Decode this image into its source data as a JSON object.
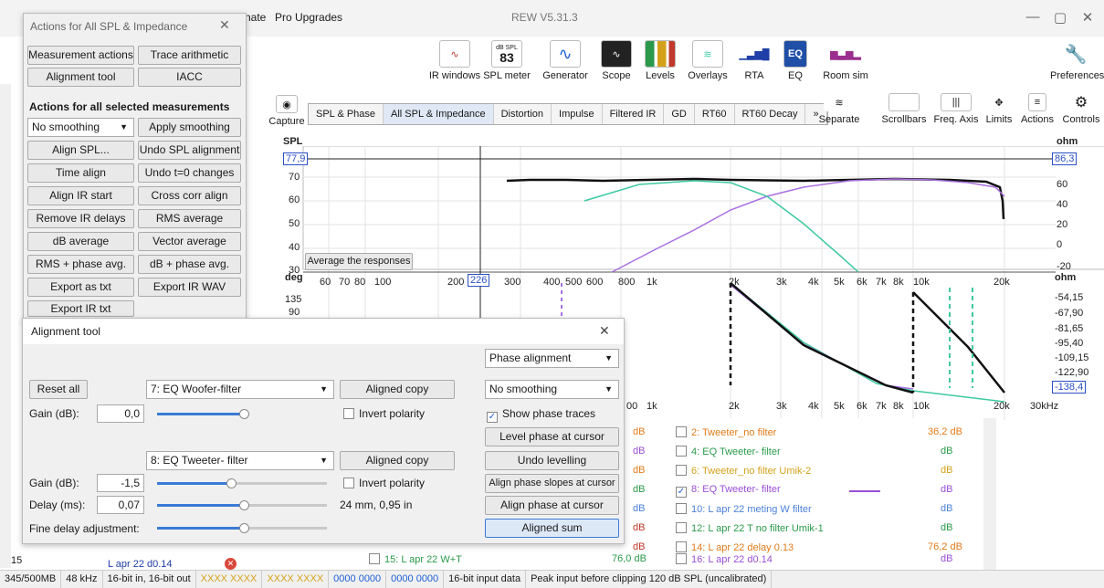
{
  "window": {
    "title": "REW V5.31.3",
    "menus": [
      "nate",
      "Pro Upgrades"
    ]
  },
  "toolbar": {
    "buttons": [
      {
        "label": "IR windows",
        "icon": "ir-windows-icon"
      },
      {
        "label": "SPL meter",
        "icon": "spl-meter-icon",
        "top": "dB SPL",
        "value": "83"
      },
      {
        "label": "Generator",
        "icon": "generator-icon"
      },
      {
        "label": "Scope",
        "icon": "scope-icon"
      },
      {
        "label": "Levels",
        "icon": "levels-icon"
      },
      {
        "label": "Overlays",
        "icon": "overlays-icon"
      },
      {
        "label": "RTA",
        "icon": "rta-icon"
      },
      {
        "label": "EQ",
        "icon": "eq-icon"
      },
      {
        "label": "Room sim",
        "icon": "room-sim-icon"
      }
    ],
    "preferences": "Preferences"
  },
  "graph_toolbar": {
    "capture": "Capture",
    "tabs": [
      "SPL & Phase",
      "All SPL & Impedance",
      "Distortion",
      "Impulse",
      "Filtered IR",
      "GD",
      "RT60",
      "RT60 Decay",
      "»"
    ],
    "selected_tab": "All SPL & Impedance",
    "controls": [
      "Separate",
      "Scrollbars",
      "Freq. Axis",
      "Limits",
      "Actions",
      "Controls"
    ]
  },
  "graph": {
    "spl_label": "SPL",
    "ohm_label": "ohm",
    "deg_label": "deg",
    "spl_cursor": "77,9",
    "ohm_cursor": "86,3",
    "spl_ticks": [
      "70",
      "60",
      "50",
      "40",
      "30"
    ],
    "ohm_ticks": [
      "60",
      "40",
      "20",
      "0",
      "-20"
    ],
    "deg_ticks": [
      "135",
      "90"
    ],
    "phase_ticks": [
      "-54,15",
      "-67,90",
      "-81,65",
      "-95,40",
      "-109,15",
      "-122,90"
    ],
    "phase_cursor": "-138,4",
    "freq_cursor": "226",
    "avg_button": "Average the responses",
    "top_freqs": [
      "60",
      "70",
      "80",
      "100",
      "200",
      "300",
      "400",
      "500",
      "600",
      "800",
      "1k",
      "2k",
      "3k",
      "4k",
      "5k",
      "6k",
      "7k",
      "8k",
      "10k",
      "20k"
    ],
    "bottom_freqs": [
      "00",
      "1k",
      "2k",
      "3k",
      "4k",
      "5k",
      "6k",
      "7k",
      "8k",
      "10k",
      "20k",
      "30kHz"
    ]
  },
  "actions_panel": {
    "title": "Actions for All SPL & Impedance",
    "buttons_top": [
      "Measurement actions",
      "Trace arithmetic",
      "Alignment tool",
      "IACC"
    ],
    "section": "Actions for all selected measurements",
    "smoothing": "No smoothing",
    "buttons": [
      "Apply smoothing",
      "Align SPL...",
      "Undo SPL alignment",
      "Time align",
      "Undo t=0 changes",
      "Align IR start",
      "Cross corr align",
      "Remove IR delays",
      "RMS average",
      "dB average",
      "Vector average",
      "RMS + phase avg.",
      "dB + phase avg.",
      "Export as txt",
      "Export IR WAV",
      "Export IR txt"
    ]
  },
  "alignment_tool": {
    "title": "Alignment tool",
    "reset": "Reset all",
    "phase_mode": "Phase alignment",
    "smoothing": "No smoothing",
    "show_phase": "Show phase traces",
    "level_phase": "Level phase at cursor",
    "undo_levelling": "Undo levelling",
    "align_slopes": "Align phase slopes at cursor",
    "align_phase": "Align phase at cursor",
    "aligned_sum": "Aligned sum",
    "m1": {
      "name": "7: EQ Woofer-filter",
      "copy": "Aligned copy",
      "gain_label": "Gain (dB):",
      "gain": "0,0",
      "invert": "Invert polarity"
    },
    "m2": {
      "name": "8: EQ Tweeter- filter",
      "copy": "Aligned copy",
      "gain_label": "Gain (dB):",
      "gain": "-1,5",
      "invert": "Invert polarity",
      "delay_label": "Delay (ms):",
      "delay": "0,07",
      "delay_info": "24 mm, 0,95 in",
      "fine_label": "Fine delay adjustment:"
    }
  },
  "measurements": [
    {
      "name": "2: Tweeter_no filter",
      "value": "36,2 dB",
      "color": "#e07b1a",
      "checked": false
    },
    {
      "name": "4: EQ Tweeter- filter",
      "value": "dB",
      "color": "#2a9a4a",
      "checked": false
    },
    {
      "name": "6: Tweeter_no filter Umik-2",
      "value": "dB",
      "color": "#d4a21a",
      "checked": false
    },
    {
      "name": "8: EQ Tweeter- filter",
      "value": "dB",
      "color": "#9b4fd6",
      "checked": true
    },
    {
      "name": "10: L apr 22 meting W filter",
      "value": "dB",
      "color": "#4a7fd6",
      "checked": false
    },
    {
      "name": "12: L apr 22 T no filter Umik-1",
      "value": "dB",
      "color": "#2a9a4a",
      "checked": false
    },
    {
      "name": "14: L apr 22 delay 0.13",
      "value": "76,2 dB",
      "color": "#e07b1a",
      "checked": false
    },
    {
      "name": "16: L apr 22 d0.14",
      "value": "dB",
      "color": "#9b4fd6",
      "checked": false
    }
  ],
  "left_list": [
    {
      "name": "15: L apr 22 W+T",
      "value": "76,0 dB",
      "color": "#2a9a4a"
    }
  ],
  "left_units": [
    "dB",
    "dB",
    "dB",
    "dB",
    "dB",
    "dB",
    "dB"
  ],
  "sidebar_rows": [
    {
      "num": "15",
      "name": "L apr 22 d0.14"
    }
  ],
  "status": [
    "345/500MB",
    "48 kHz",
    "16-bit in, 16-bit out",
    "XXXX XXXX",
    "XXXX XXXX",
    "0000 0000",
    "0000 0000",
    "16-bit input data",
    "Peak input before clipping 120 dB SPL (uncalibrated)"
  ],
  "colors": {
    "accent": "#2b50c4",
    "purple": "#a970e0",
    "teal": "#3ec9a0",
    "black": "#111111"
  }
}
